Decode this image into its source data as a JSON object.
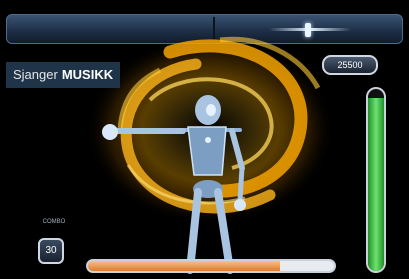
{
  "hud": {
    "genre_prefix": "Sjanger",
    "genre_value": "MUSIKK",
    "score": "25500",
    "combo_caption": "COMBO",
    "combo_value": "30",
    "energy_level": 0.95,
    "song_progress": 0.78
  },
  "colors": {
    "energy": "#4ccf4c",
    "progress": "#f0a060",
    "aura": "#f5a300",
    "robot": "#a9c4e0",
    "topbar": "#2b4060"
  },
  "icons": [
    "robot-dancer",
    "energy-swirl"
  ]
}
